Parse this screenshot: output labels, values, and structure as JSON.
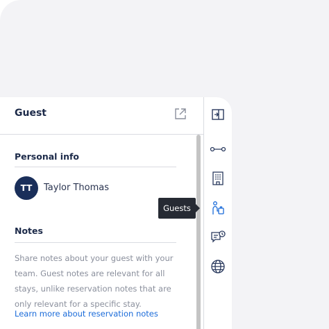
{
  "panel": {
    "title": "Guest",
    "open_external_icon": "external-link-icon"
  },
  "personal_info": {
    "title": "Personal info",
    "avatar_initials": "TT",
    "guest_name": "Taylor Thomas"
  },
  "notes": {
    "title": "Notes",
    "body": "Share notes about your guest with your team. Guest notes are relevant for all stays, unlike reservation notes that are only relevant for a specific stay.",
    "link": "Learn more about reservation notes"
  },
  "sidebar": {
    "items": [
      {
        "icon": "collapse-panel-icon"
      },
      {
        "icon": "timeline-icon"
      },
      {
        "icon": "building-icon"
      },
      {
        "icon": "guest-luggage-icon"
      },
      {
        "icon": "chat-history-icon"
      },
      {
        "icon": "globe-icon"
      }
    ],
    "tooltip": "Guests"
  },
  "colors": {
    "accent": "#1a6bd9",
    "avatar": "#1a2f5a",
    "tooltip": "#262a33",
    "icon": "#2a3a5e"
  }
}
